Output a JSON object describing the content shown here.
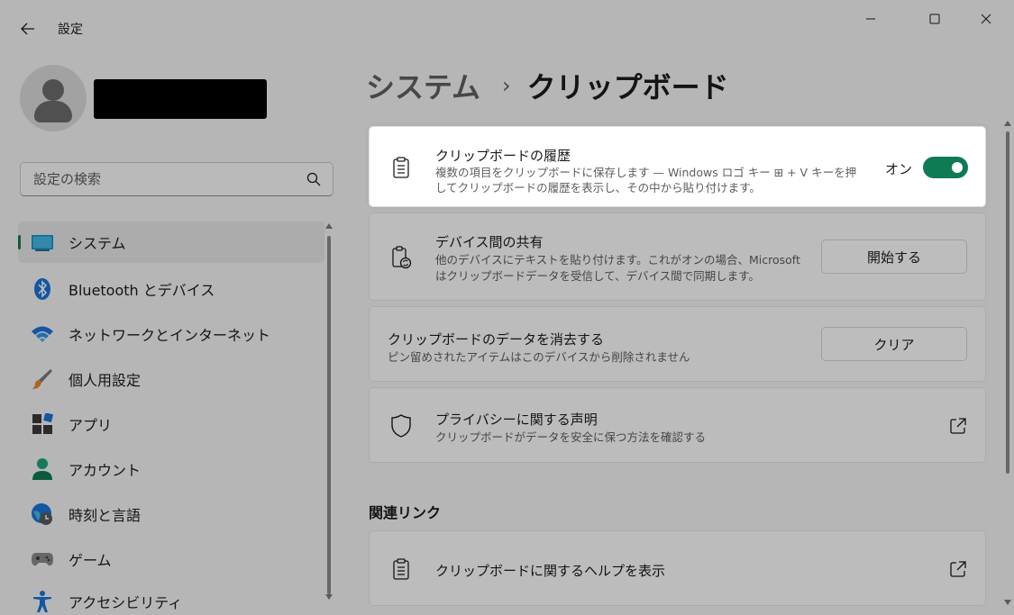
{
  "window": {
    "title": "設定"
  },
  "search": {
    "placeholder": "設定の検索"
  },
  "nav": {
    "items": [
      {
        "label": "システム",
        "icon": "monitor-icon"
      },
      {
        "label": "Bluetooth とデバイス",
        "icon": "bluetooth-icon"
      },
      {
        "label": "ネットワークとインターネット",
        "icon": "wifi-icon"
      },
      {
        "label": "個人用設定",
        "icon": "brush-icon"
      },
      {
        "label": "アプリ",
        "icon": "apps-icon"
      },
      {
        "label": "アカウント",
        "icon": "account-icon"
      },
      {
        "label": "時刻と言語",
        "icon": "globe-clock-icon"
      },
      {
        "label": "ゲーム",
        "icon": "gamepad-icon"
      },
      {
        "label": "アクセシビリティ",
        "icon": "accessibility-icon"
      }
    ]
  },
  "breadcrumb": {
    "parent": "システム",
    "separator": "›",
    "current": "クリップボード"
  },
  "cards": {
    "history": {
      "title": "クリップボードの履歴",
      "desc_line1": "複数の項目をクリップボードに保存します — Windows ロゴ キー ⊞ + V キーを押",
      "desc_line2": "してクリップボードの履歴を表示し、その中から貼り付けます。",
      "toggle_label": "オン",
      "toggle_on": true
    },
    "sync": {
      "title": "デバイス間の共有",
      "desc_line1": "他のデバイスにテキストを貼り付けます。これがオンの場合、Microsoft",
      "desc_line2": "はクリップボードデータを受信して、デバイス間で同期します。",
      "button": "開始する"
    },
    "clear": {
      "title": "クリップボードのデータを消去する",
      "desc": "ピン留めされたアイテムはこのデバイスから削除されません",
      "button": "クリア"
    },
    "privacy": {
      "title": "プライバシーに関する声明",
      "desc": "クリップボードがデータを安全に保つ方法を確認する"
    }
  },
  "related": {
    "section_title": "関連リンク",
    "help_title": "クリップボードに関するヘルプを表示"
  },
  "colors": {
    "accent": "#0f7b55",
    "background": "#f3f3f3"
  }
}
